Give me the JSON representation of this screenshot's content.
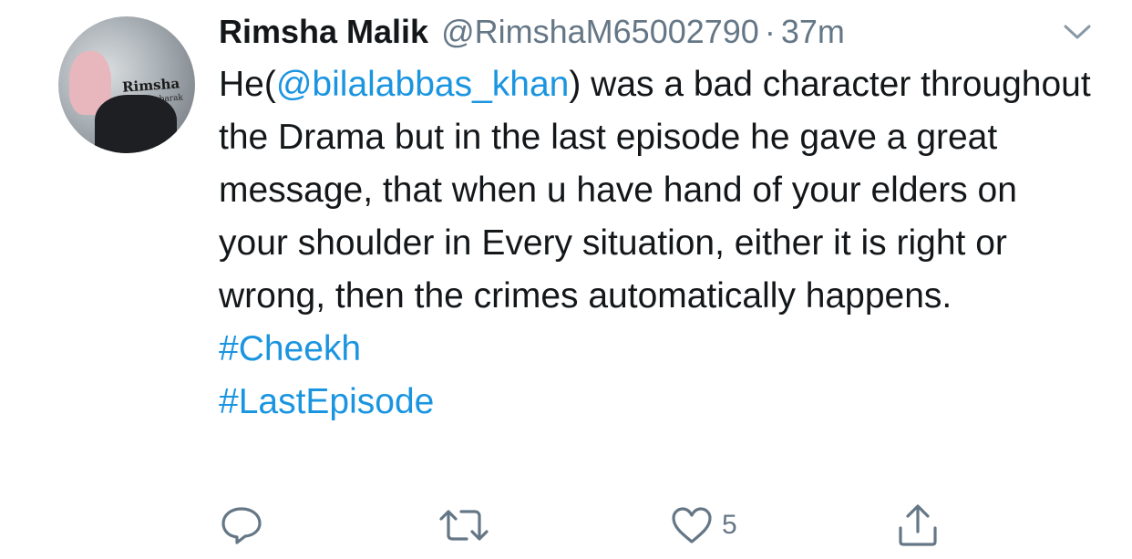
{
  "tweet": {
    "author_name": "Rimsha Malik",
    "author_handle": "@RimshaM65002790",
    "separator": "·",
    "time": "37m",
    "avatar": {
      "name_text": "Rimsha",
      "sub_text": "Hajj Mubarak"
    },
    "text": {
      "prefix": "He(",
      "mention": "@bilalabbas_khan",
      "body": ") was a bad character throughout the Drama but in the last episode he gave a great message, that when u have hand of your elders on your shoulder in Every situation, either it is right or wrong, then the crimes automatically happens."
    },
    "hashtags": [
      "#Cheekh",
      "#LastEpisode"
    ],
    "actions": {
      "reply_icon": "reply-icon",
      "retweet_icon": "retweet-icon",
      "like_icon": "heart-icon",
      "like_count": "5",
      "share_icon": "share-icon"
    },
    "menu_icon": "chevron-down-icon"
  },
  "colors": {
    "text": "#14171a",
    "secondary": "#657786",
    "link": "#1b95e0"
  }
}
